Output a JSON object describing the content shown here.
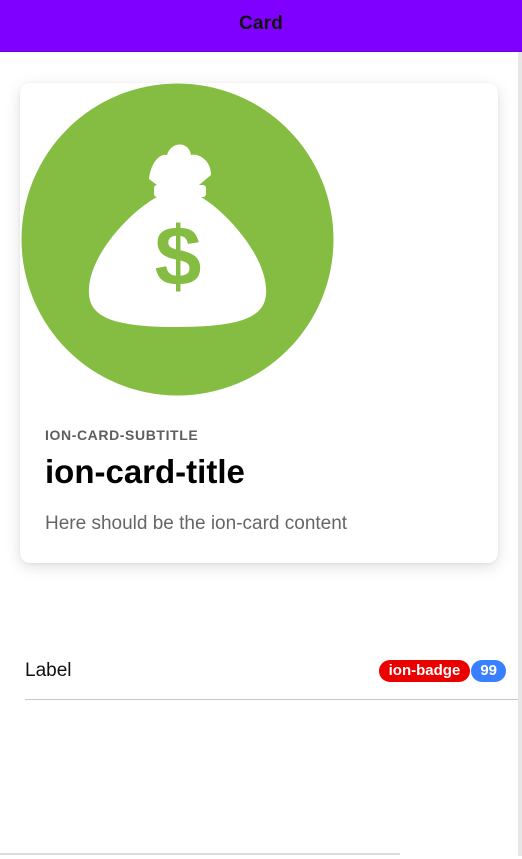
{
  "toolbar": {
    "title": "Card"
  },
  "card": {
    "image_icon": "money-bag-dollar-icon",
    "image_bg_color": "#84bd41",
    "subtitle": "ion-card-subtitle",
    "title": "ion-card-title",
    "content": "Here should be the ion-card content"
  },
  "item": {
    "label": "Label",
    "badges": [
      {
        "text": "ion-badge",
        "color": "#eb0000"
      },
      {
        "text": "99",
        "color": "#3880ff"
      }
    ]
  },
  "colors": {
    "toolbar_bg": "#8000ff",
    "card_image_green": "#84bd41"
  }
}
